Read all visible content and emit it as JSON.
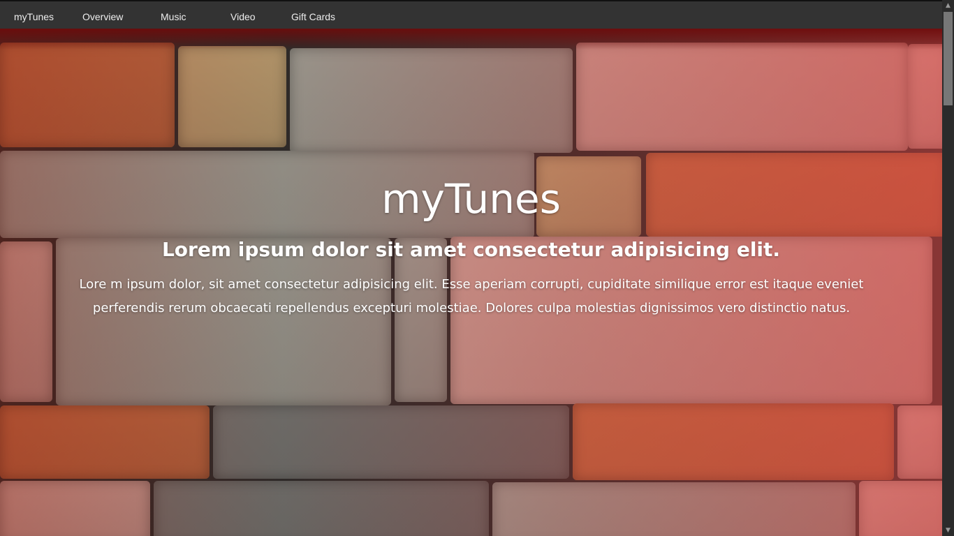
{
  "nav": {
    "brand": "myTunes",
    "items": [
      "Overview",
      "Music",
      "Video",
      "Gift Cards"
    ]
  },
  "hero": {
    "title": "myTunes",
    "subtitle": "Lorem ipsum dolor sit amet consectetur adipisicing elit.",
    "body": "Lore m ipsum dolor, sit amet consectetur adipisicing elit. Esse aperiam corrupti, cupiditate similique error est itaque eveniet perferendis rerum obcaecati repellendus excepturi molestiae. Dolores culpa molestias dignissimos vero distinctio natus."
  },
  "colors": {
    "nav_bg": "#333333",
    "overlay": "#e04646"
  },
  "scrollbar": {
    "position_percent": 0
  }
}
